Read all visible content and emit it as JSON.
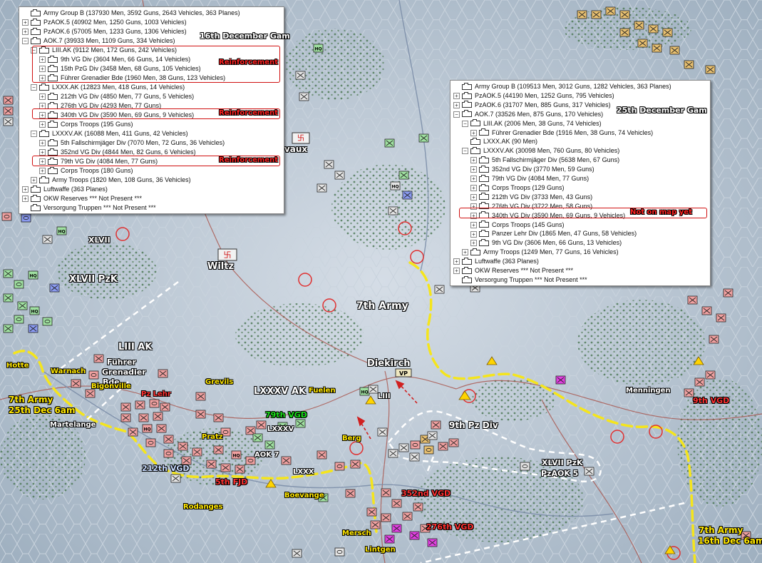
{
  "colors": {
    "front_line": "#f5e51c",
    "white_line": "#ffffff",
    "highlight": "#d01010",
    "german_unit": "#f0a0a0",
    "panel_bg": "#ffffff"
  },
  "panel_16dec": {
    "title": "16th December Gam",
    "rows": [
      {
        "expander": "",
        "label": "Army Group B (137930 Men, 3592 Guns, 2643 Vehicles, 363 Planes)"
      },
      {
        "expander": "+",
        "label": "PzAOK.5 (40902 Men, 1250 Guns, 1003 Vehicles)"
      },
      {
        "expander": "+",
        "label": "PzAOK.6 (57005 Men, 1233 Guns, 1306 Vehicles)"
      },
      {
        "expander": "−",
        "label": "AOK.7 (39933 Men, 1109 Guns, 334 Vehicles)"
      },
      {
        "expander": "−",
        "label": "LIII.AK (9112 Men, 172 Guns, 242 Vehicles)"
      },
      {
        "expander": "+",
        "label": "9th VG Div (3604 Men, 66 Guns, 14 Vehicles)"
      },
      {
        "expander": "+",
        "label": "15th PzG Div (3458 Men, 68 Guns, 105 Vehicles)"
      },
      {
        "expander": "+",
        "label": "Führer Grenadier Bde (1960 Men, 38 Guns, 123 Vehicles)"
      },
      {
        "expander": "−",
        "label": "LXXX.AK (12823 Men, 418 Guns, 14 Vehicles)"
      },
      {
        "expander": "+",
        "label": "212th VG Div (4850 Men, 77 Guns, 5 Vehicles)"
      },
      {
        "expander": "+",
        "label": "276th VG Div (4293 Men, 77 Guns)"
      },
      {
        "expander": "+",
        "label": "340th VG Div (3590 Men, 69 Guns, 9 Vehicles)"
      },
      {
        "expander": "+",
        "label": "Corps Troops (195 Guns)"
      },
      {
        "expander": "−",
        "label": "LXXXV.AK (16088 Men, 411 Guns, 42 Vehicles)"
      },
      {
        "expander": "+",
        "label": "5th Fallschirmjäger Div (7070 Men, 72 Guns, 36 Vehicles)"
      },
      {
        "expander": "+",
        "label": "352nd VG Div (4844 Men, 82 Guns, 6 Vehicles)"
      },
      {
        "expander": "+",
        "label": "79th VG Div (4084 Men, 77 Guns)"
      },
      {
        "expander": "+",
        "label": "Corps Troops (180 Guns)"
      },
      {
        "expander": "+",
        "label": "Army Troops (1820 Men, 108 Guns, 36 Vehicles)"
      },
      {
        "expander": "+",
        "label": "Luftwaffe (363 Planes)"
      },
      {
        "expander": "+",
        "label": "OKW Reserves *** Not Present ***"
      },
      {
        "expander": "",
        "label": "Versorgung Truppen *** Not Present ***"
      }
    ],
    "tags": [
      "Reinforcement",
      "Reinforcement",
      "Reinforcement"
    ]
  },
  "panel_25dec": {
    "title": "25th December Gam",
    "rows": [
      {
        "expander": "",
        "label": "Army Group B (109513 Men, 3012 Guns, 1282 Vehicles, 363 Planes)"
      },
      {
        "expander": "+",
        "label": "PzAOK.5 (44190 Men, 1252 Guns, 795 Vehicles)"
      },
      {
        "expander": "+",
        "label": "PzAOK.6 (31707 Men, 885 Guns, 317 Vehicles)"
      },
      {
        "expander": "−",
        "label": "AOK.7 (33526 Men, 875 Guns, 170 Vehicles)"
      },
      {
        "expander": "−",
        "label": "LIII.AK (2006 Men, 38 Guns, 74 Vehicles)"
      },
      {
        "expander": "+",
        "label": "Führer Grenadier Bde (1916 Men, 38 Guns, 74 Vehicles)"
      },
      {
        "expander": "",
        "label": "LXXX.AK (90 Men)"
      },
      {
        "expander": "−",
        "label": "LXXXV.AK (30098 Men, 760 Guns, 80 Vehicles)"
      },
      {
        "expander": "+",
        "label": "5th Fallschirmjäger Div (5638 Men, 67 Guns)"
      },
      {
        "expander": "+",
        "label": "352nd VG Div (3770 Men, 59 Guns)"
      },
      {
        "expander": "+",
        "label": "79th VG Div (4084 Men, 77 Guns)"
      },
      {
        "expander": "+",
        "label": "Corps Troops (129 Guns)"
      },
      {
        "expander": "+",
        "label": "212th VG Div (3733 Men, 43 Guns)"
      },
      {
        "expander": "+",
        "label": "276th VG Div (3722 Men, 58 Guns)"
      },
      {
        "expander": "+",
        "label": "340th VG Div (3590 Men, 69 Guns, 9 Vehicles)"
      },
      {
        "expander": "+",
        "label": "Corps Troops (145 Guns)"
      },
      {
        "expander": "+",
        "label": "Panzer Lehr Div (1865 Men, 47 Guns, 58 Vehicles)"
      },
      {
        "expander": "+",
        "label": "9th VG Div (3606 Men, 66 Guns, 13 Vehicles)"
      },
      {
        "expander": "+",
        "label": "Army Troops (1249 Men, 77 Guns, 16 Vehicles)"
      },
      {
        "expander": "+",
        "label": "Luftwaffe (363 Planes)"
      },
      {
        "expander": "+",
        "label": "OKW Reserves *** Not Present ***"
      },
      {
        "expander": "",
        "label": "Versorgung Truppen *** Not Present ***"
      }
    ],
    "tags": [
      "Not on map yet"
    ]
  },
  "map_labels": {
    "wiltz": "Wiltz",
    "clervaux": "rvaux",
    "xlvii": "XLVII",
    "xlvii_pzk": "XLVII PzK",
    "seventh_army": "7th Army",
    "liii_ak": "LIII AK",
    "fuhrer_grenadier": "Führer",
    "fuhrer_grenadier_2": "Grenadier",
    "fuhrer_grenadier_3": "Bde",
    "hotte": "Hotte",
    "warnach": "Warnach",
    "bigonville": "Bigonville",
    "pz_lehr": "Pz Lehr",
    "grevils": "Grevils",
    "lxxxv_ak": "LXXXV AK",
    "fuelen": "Fuelen",
    "diekirch": "Diekirch",
    "liii": "LIII",
    "army7_25dec_a": "7th Army",
    "army7_25dec_b": "25th Dec 6am",
    "martelange": "Martelange",
    "vgd79": "79th VGD",
    "lxxxv": "LXXXV",
    "pratz": "Pratz",
    "aok7": "AOK 7",
    "berg": "Berg",
    "pz9": "9th Pz Div",
    "xlvii_pzk_b": "XLVII PzK",
    "pzaok5": "PzAOK 5",
    "menningen": "Menningen",
    "vgd9": "9th VGD",
    "vgd212": "212th VGD",
    "lxxx": "LXXX",
    "fjd5": "5th FJD",
    "boevange": "Boevange",
    "rodanges": "Rodanges",
    "vgd352": "352nd VGD",
    "vgd276": "276th VGD",
    "mersch": "Mersch",
    "lintgen": "Lintgen",
    "army7_16dec_a": "7th Army",
    "army7_16dec_b": "16th Dec 6am",
    "vp": "VP",
    "hq": "HQ"
  }
}
